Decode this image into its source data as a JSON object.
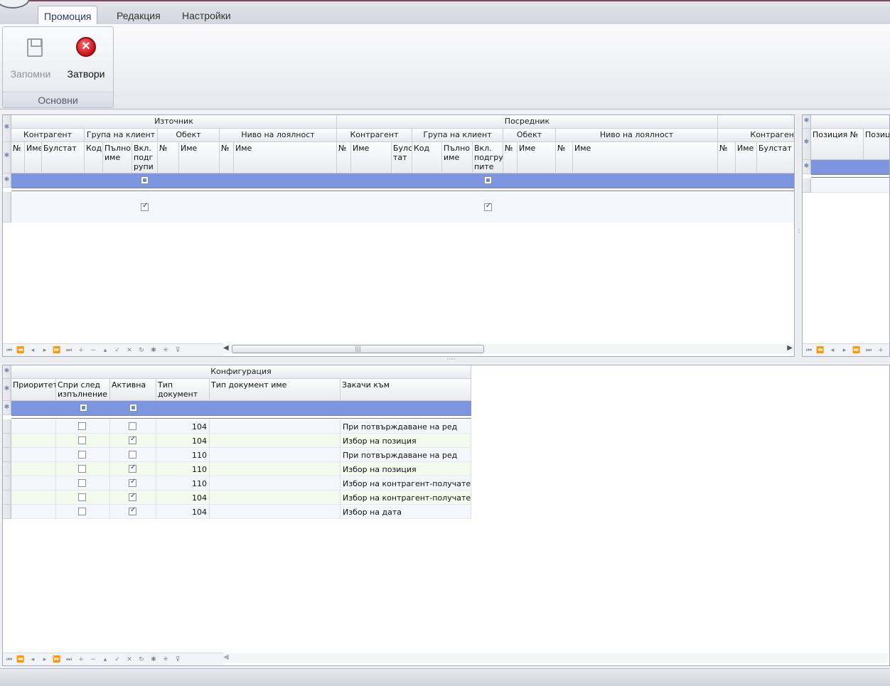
{
  "ribbon": {
    "tabs": [
      {
        "label": "Промоция"
      },
      {
        "label": "Редакция"
      },
      {
        "label": "Настройки"
      }
    ],
    "group_label": "Основни",
    "save_label": "Запомни",
    "close_label": "Затвори"
  },
  "top_grid": {
    "bands": [
      "Източник",
      "Посредник",
      "Контрагент"
    ],
    "subbands": [
      "Контрагент",
      "Група на клиент",
      "Обект",
      "Ниво на лоялност",
      "Контрагент",
      "Група на клиент",
      "Обект",
      "Ниво на лоялност"
    ],
    "columns": [
      "№",
      "Име",
      "Булстат",
      "Код",
      "Пълно име",
      "Вкл. подгрупите",
      "№",
      "Име",
      "№",
      "Име",
      "№",
      "Име",
      "Булстат",
      "Код",
      "Пълно име",
      "Вкл. подгрупите",
      "№",
      "Име",
      "№",
      "Име",
      "№",
      "Име",
      "Булстат"
    ]
  },
  "top_grid_2": {
    "partial_band": "Контраген",
    "columns": [
      "Булс тат",
      "Пълно име",
      "Вкл. подгру пите"
    ]
  },
  "side_grid": {
    "columns": [
      "Позиция №",
      "Позици"
    ]
  },
  "config_grid": {
    "band": "Конфигурация",
    "columns": [
      "Приоритет",
      "Спри след изпълнение",
      "Активна",
      "Тип документ №",
      "Тип документ име",
      "Закачи към"
    ],
    "rows": [
      {
        "stop": false,
        "active": false,
        "doc_no": "104",
        "attach": "При потвърждаване на ред"
      },
      {
        "stop": false,
        "active": true,
        "doc_no": "104",
        "attach": "Избор на позиция"
      },
      {
        "stop": false,
        "active": false,
        "doc_no": "110",
        "attach": "При потвърждаване на ред"
      },
      {
        "stop": false,
        "active": true,
        "doc_no": "110",
        "attach": "Избор на позиция"
      },
      {
        "stop": false,
        "active": true,
        "doc_no": "110",
        "attach": "Избор на контрагент-получател"
      },
      {
        "stop": false,
        "active": true,
        "doc_no": "104",
        "attach": "Избор на контрагент-получател"
      },
      {
        "stop": false,
        "active": true,
        "doc_no": "104",
        "attach": "Избор на дата"
      }
    ]
  },
  "icons": {
    "save": "floppy-disk-icon",
    "close": "red-x-circle-icon",
    "nav": [
      "first-icon",
      "prev-page-icon",
      "prev-icon",
      "next-icon",
      "next-page-icon",
      "last-icon",
      "add-icon",
      "remove-icon",
      "up-icon",
      "check-icon",
      "cancel-icon",
      "refresh-icon",
      "star-icon",
      "asterisk-icon",
      "filter-icon"
    ]
  }
}
